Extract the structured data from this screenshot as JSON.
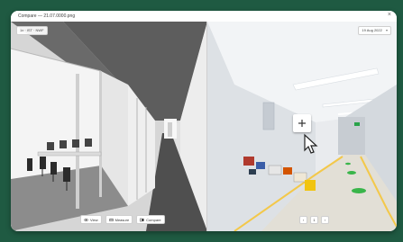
{
  "window": {
    "title": "Compare — 21.07.0000.png"
  },
  "left_view": {
    "scale_label": "1x  ·  IST  ·  NWF"
  },
  "right_view": {
    "date_label": "19 Aug 2022"
  },
  "toolbar": {
    "view_label": "View",
    "measure_label": "Measure",
    "compare_label": "Compare"
  },
  "pager": {
    "prev": "‹",
    "page": "1",
    "next": "›"
  },
  "colors": {
    "accent": "#1f5a42",
    "safety_line": "#f3c84a",
    "floor_marker": "#39b54a"
  }
}
